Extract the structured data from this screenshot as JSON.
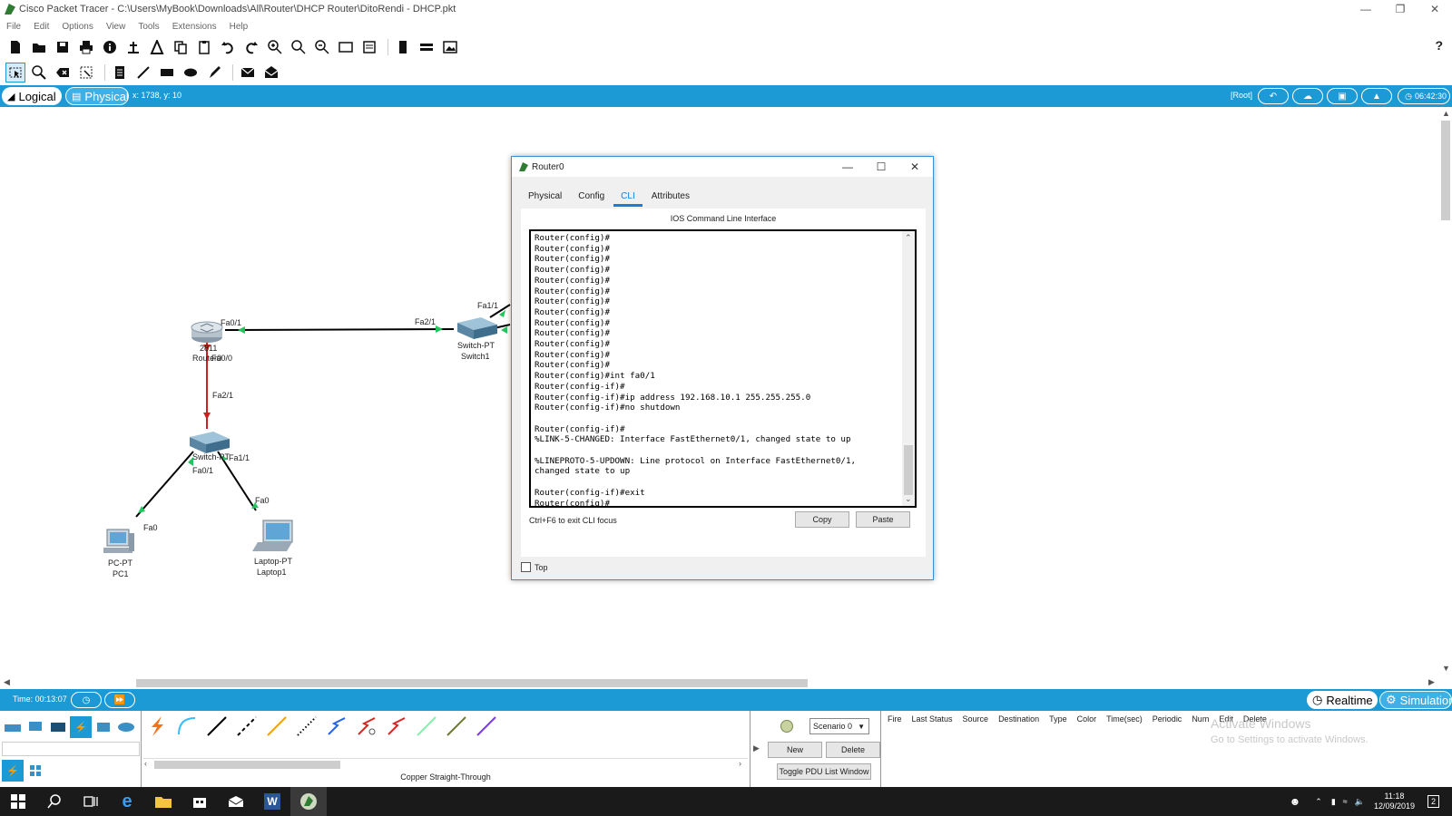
{
  "window": {
    "title": "Cisco Packet Tracer - C:\\Users\\MyBook\\Downloads\\All\\Router\\DHCP Router\\DitoRendi - DHCP.pkt"
  },
  "menu": [
    "File",
    "Edit",
    "Options",
    "View",
    "Tools",
    "Extensions",
    "Help"
  ],
  "modebar": {
    "logical": "Logical",
    "physical": "Physical",
    "coords": "x: 1738, y: 10",
    "root": "[Root]",
    "clock": "06:42:30"
  },
  "topology": {
    "devices": [
      {
        "model": "2811",
        "name": "Router0"
      },
      {
        "model": "Switch-PT",
        "name": "Switch1"
      },
      {
        "model": "Switch-PT",
        "name": "Switch0"
      },
      {
        "model": "PC-PT",
        "name": "PC1"
      },
      {
        "model": "Laptop-PT",
        "name": "Laptop1"
      }
    ],
    "ports": {
      "router_fa01": "Fa0/1",
      "router_fa00": "Fa0/0",
      "switch1_fa21": "Fa2/1",
      "switch1_fa11": "Fa1/1",
      "switch0_fa21": "Fa2/1",
      "switch0_fa11": "Fa1/1",
      "switch0_fa01": "Fa0/1",
      "pc_fa0": "Fa0",
      "laptop_fa0": "Fa0"
    }
  },
  "dialog": {
    "title": "Router0",
    "tabs": [
      "Physical",
      "Config",
      "CLI",
      "Attributes"
    ],
    "active_tab": "CLI",
    "cli_title": "IOS Command Line Interface",
    "cli_text": "Router(config)#\nRouter(config)#\nRouter(config)#\nRouter(config)#\nRouter(config)#\nRouter(config)#\nRouter(config)#\nRouter(config)#\nRouter(config)#\nRouter(config)#\nRouter(config)#\nRouter(config)#\nRouter(config)#\nRouter(config)#int fa0/1\nRouter(config-if)#\nRouter(config-if)#ip address 192.168.10.1 255.255.255.0\nRouter(config-if)#no shutdown\n\nRouter(config-if)#\n%LINK-5-CHANGED: Interface FastEthernet0/1, changed state to up\n\n%LINEPROTO-5-UPDOWN: Line protocol on Interface FastEthernet0/1,\nchanged state to up\n\nRouter(config-if)#exit\nRouter(config)#",
    "hint": "Ctrl+F6 to exit CLI focus",
    "copy": "Copy",
    "paste": "Paste",
    "top_checkbox": "Top"
  },
  "statusbar": {
    "time": "Time: 00:13:07",
    "realtime": "Realtime",
    "simulation": "Simulation"
  },
  "bottom": {
    "connection_name": "Copper Straight-Through",
    "scenario": "Scenario 0",
    "new": "New",
    "delete": "Delete",
    "toggle_pdu": "Toggle PDU List Window",
    "pdu_columns": [
      "Fire",
      "Last Status",
      "Source",
      "Destination",
      "Type",
      "Color",
      "Time(sec)",
      "Periodic",
      "Num",
      "Edit",
      "Delete"
    ],
    "watermark_title": "Activate Windows",
    "watermark_sub": "Go to Settings to activate Windows."
  },
  "taskbar": {
    "time": "11:18",
    "date": "12/09/2019",
    "notifications": "2"
  },
  "colors": {
    "accent": "#1b9ad6",
    "link_up": "#22c55e",
    "link_down": "#cc1f1f"
  }
}
